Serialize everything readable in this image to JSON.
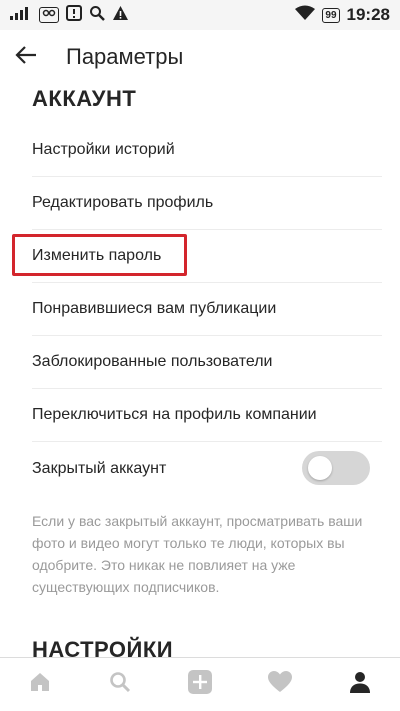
{
  "status_bar": {
    "signal": "ıl",
    "battery_badge": "99",
    "time": "19:28",
    "icons": [
      "signal-icon",
      "sim-icon",
      "alert-icon",
      "search-icon",
      "warning-icon",
      "wifi-icon",
      "battery-icon"
    ]
  },
  "header": {
    "title": "Параметры",
    "back_icon": "arrow-left-icon"
  },
  "sections": {
    "account_title": "АККАУНТ",
    "settings_title": "НАСТРОЙКИ"
  },
  "account_items": [
    "Настройки историй",
    "Редактировать профиль",
    "Изменить пароль",
    "Понравившиеся вам публикации",
    "Заблокированные пользователи",
    "Переключиться на профиль компании"
  ],
  "private_account": {
    "label": "Закрытый аккаунт",
    "enabled": false,
    "note": "Если у вас закрытый аккаунт, просматривать ваши фото и видео могут только те люди, которых вы одобрите. Это никак не повлияет на уже существующих подписчиков."
  },
  "highlight_color": "#d3252c",
  "bottom_nav": [
    "home-icon",
    "search-icon",
    "add-icon",
    "heart-icon",
    "profile-icon"
  ]
}
